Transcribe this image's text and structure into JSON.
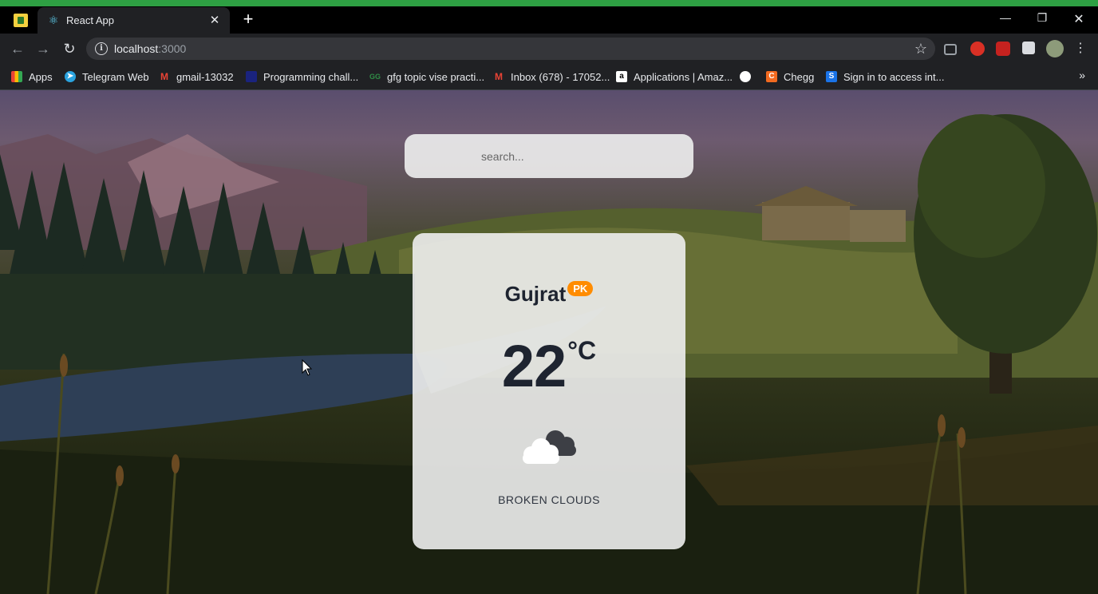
{
  "browser": {
    "tab": {
      "title": "React App",
      "favicon": "react-icon",
      "close": "✕"
    },
    "new_tab": "+",
    "window_controls": {
      "minimize": "—",
      "restore": "❐",
      "close": "✕"
    },
    "address": {
      "host": "localhost",
      "port": ":3000"
    }
  },
  "bookmarks": [
    {
      "label": "Apps",
      "icon": "apps-grid-icon",
      "color": "#ea4335"
    },
    {
      "label": "Telegram Web",
      "icon": "telegram-icon",
      "color": "#2aa3df"
    },
    {
      "label": "gmail-13032",
      "icon": "gmail-icon",
      "color": "#ea4335"
    },
    {
      "label": "Programming chall...",
      "icon": "bookmark-site-icon",
      "color": "#1a237e"
    },
    {
      "label": "gfg topic vise practi...",
      "icon": "gfg-icon",
      "color": "#2f8d46"
    },
    {
      "label": "Inbox (678) - 17052...",
      "icon": "gmail-icon",
      "color": "#ea4335"
    },
    {
      "label": "Applications | Amaz...",
      "icon": "amazon-icon",
      "color": "#ffffff"
    },
    {
      "label": "",
      "icon": "globe-icon",
      "color": "#ffffff"
    },
    {
      "label": "Chegg",
      "icon": "chegg-icon",
      "color": "#f26a20"
    },
    {
      "label": "Sign in to access int...",
      "icon": "s-icon",
      "color": "#1a73e8"
    }
  ],
  "bookmarks_more": "»",
  "page": {
    "search": {
      "placeholder": "search...",
      "value": ""
    },
    "weather": {
      "city": "Gujrat",
      "country": "PK",
      "temperature": "22",
      "unit": "°C",
      "description": "BROKEN CLOUDS",
      "icon": "broken-clouds-icon"
    }
  },
  "colors": {
    "accent_badge": "#ff8c00",
    "card_bg": "#eeeeee",
    "chrome_frame": "#000000",
    "chrome_toolbar": "#202124",
    "top_stripe": "#2ea043"
  }
}
